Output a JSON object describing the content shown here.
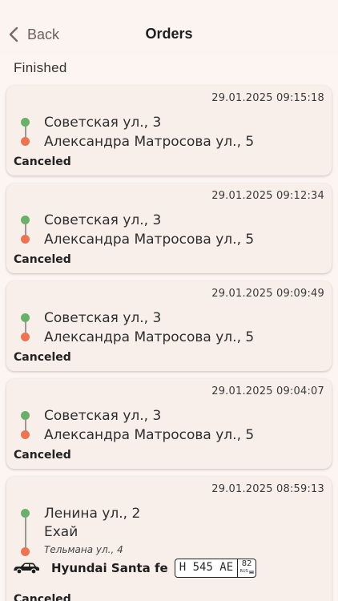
{
  "nav": {
    "back_label": "Back",
    "title": "Orders"
  },
  "section_label": "Finished",
  "orders": [
    {
      "date": "29.01.2025 09:15:18",
      "from": "Советская ул., 3",
      "to": "Александра Матросова ул., 5",
      "status": "Canceled"
    },
    {
      "date": "29.01.2025 09:12:34",
      "from": "Советская ул., 3",
      "to": "Александра Матросова ул., 5",
      "status": "Canceled"
    },
    {
      "date": "29.01.2025 09:09:49",
      "from": "Советская ул., 3",
      "to": "Александра Матросова ул., 5",
      "status": "Canceled"
    },
    {
      "date": "29.01.2025 09:04:07",
      "from": "Советская ул., 3",
      "to": "Александра Матросова ул., 5",
      "status": "Canceled"
    },
    {
      "date": "29.01.2025 08:59:13",
      "from": "Ленина ул., 2",
      "to": "Ехай",
      "to_sub": "Тельмана ул., 4",
      "car": "Hyundai Santa fe",
      "plate_number": "Н 545 АЕ",
      "plate_region": "82",
      "plate_country": "RUS",
      "status": "Canceled"
    }
  ],
  "colors": {
    "from_dot": "#6ab06b",
    "to_dot": "#ea7453",
    "card_bg": "#f8efeb",
    "page_bg": "#fdf5f2"
  },
  "icons": {
    "back": "chevron-left-icon",
    "car": "car-icon",
    "flag": "russia-flag-icon"
  }
}
